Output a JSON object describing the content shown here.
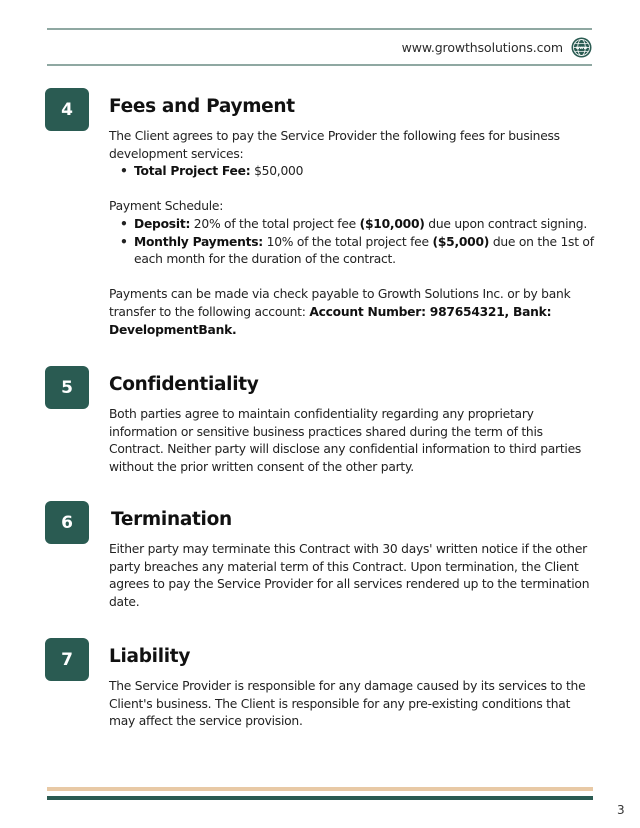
{
  "header": {
    "website": "www.growthsolutions.com",
    "icon": "globe-icon"
  },
  "sections": [
    {
      "number": "4",
      "title": "Fees and Payment",
      "intro": "The Client agrees to pay the Service Provider the following fees for business development services:",
      "fee_items": [
        {
          "label": "Total Project Fee:",
          "text": " $50,000"
        }
      ],
      "schedule_label": "Payment Schedule:",
      "schedule_items": [
        {
          "label": "Deposit:",
          "pre": " 20% of the total project fee ",
          "amount": "($10,000)",
          "post": " due upon contract signing."
        },
        {
          "label": "Monthly Payments:",
          "pre": " 10% of the total project fee ",
          "amount": "($5,000)",
          "post": " due on the 1st of each month for the duration of the contract."
        }
      ],
      "payment_text": "Payments can be made via check payable to Growth Solutions Inc. or by bank transfer to the following account: ",
      "payment_bold": "Account Number: 987654321, Bank: DevelopmentBank."
    },
    {
      "number": "5",
      "title": "Confidentiality",
      "body": "Both parties agree to maintain confidentiality regarding any proprietary information or sensitive business practices shared during the term of this Contract. Neither party will disclose any confidential information to third parties without the prior written consent of the other party."
    },
    {
      "number": "6",
      "title": "Termination",
      "body": "Either party may terminate this Contract with 30 days' written notice if the other party breaches any material term of this Contract. Upon termination, the Client agrees to pay the Service Provider for all services rendered up to the termination date."
    },
    {
      "number": "7",
      "title": "Liability",
      "body": "The Service Provider is responsible for any damage caused by its services to the Client's business. The Client is responsible for any pre-existing conditions that may affect the service provision."
    }
  ],
  "footer": {
    "page_number": "3"
  },
  "colors": {
    "accent": "#2a5b52",
    "footer_beige": "#e8c9a5",
    "rule": "#8fa8a2"
  }
}
